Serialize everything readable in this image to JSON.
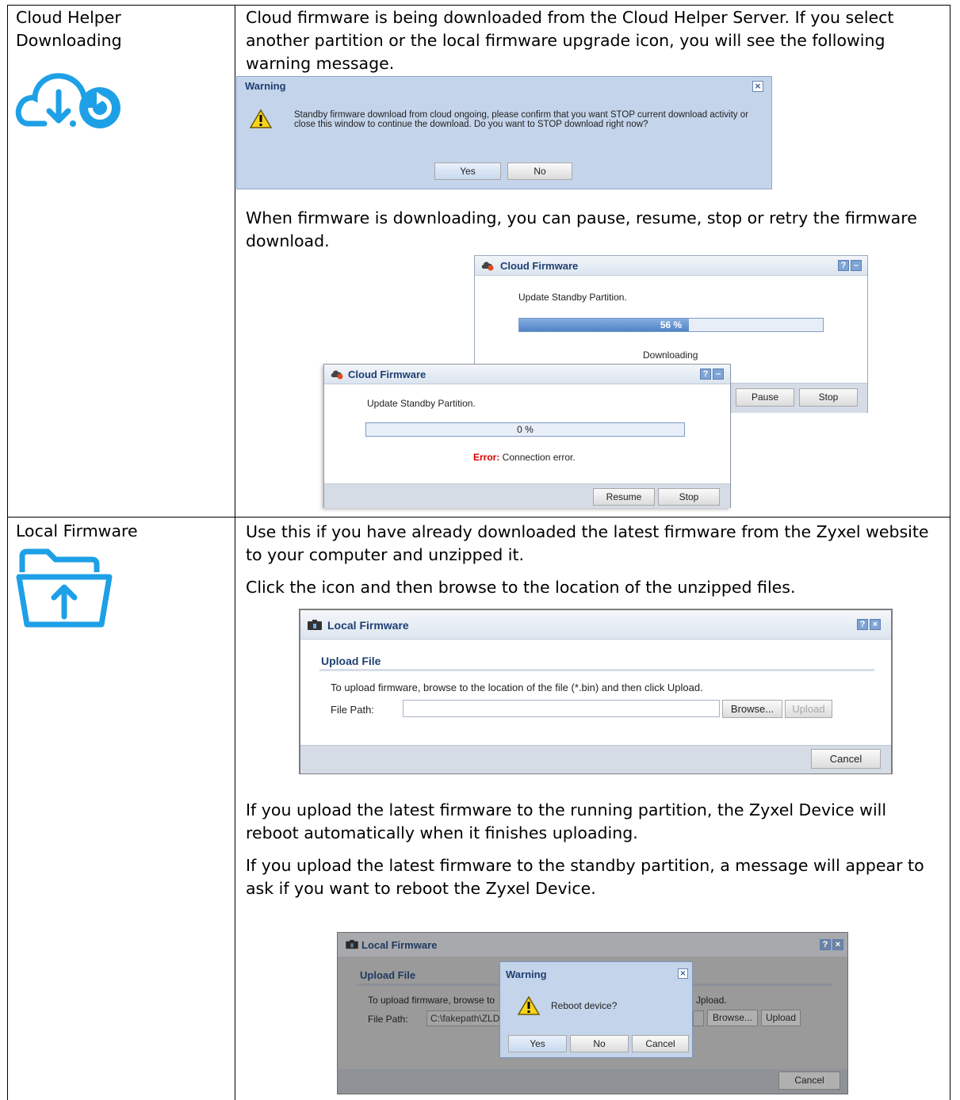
{
  "rows": [
    {
      "label": "Cloud Helper Downloading",
      "icon": "cloud-download-refresh-icon",
      "paragraphs": [
        "Cloud firmware is being downloaded from the Cloud Helper Server. If you select another partition or the local firmware upgrade icon, you will see the following warning message.",
        "When firmware is downloading, you can pause, resume, stop or retry the firmware download."
      ],
      "warning_dialog": {
        "title": "Warning",
        "message": "Standby firmware download from cloud ongoing, please confirm that you want STOP current download activity or close this window to continue the download. Do you want to STOP download right now?",
        "yes": "Yes",
        "no": "No"
      },
      "cloud_dialog_progress": {
        "title": "Cloud Firmware",
        "task": "Update Standby Partition.",
        "progress_text": "56 %",
        "progress": 0.56,
        "status": "Downloading",
        "pause": "Pause",
        "stop": "Stop"
      },
      "cloud_dialog_error": {
        "title": "Cloud Firmware",
        "task": "Update Standby Partition.",
        "progress_text": "0 %",
        "progress": 0,
        "error_label": "Error:",
        "error_text": " Connection error.",
        "resume": "Resume",
        "stop": "Stop"
      }
    },
    {
      "label": "Local Firmware",
      "icon": "folder-upload-icon",
      "paragraphs": [
        "Use this if you have already downloaded the latest firmware from the Zyxel website to your computer and unzipped it.",
        "Click the icon and then browse to the location of the unzipped files.",
        "If you upload the latest firmware to the running partition, the Zyxel Device will reboot automatically when it finishes uploading.",
        "If you upload the latest firmware to the standby partition, a message will appear to ask if you want to reboot the Zyxel Device."
      ],
      "local_dialog": {
        "title": "Local Firmware",
        "section": "Upload File",
        "instruction": "To upload firmware, browse to the location of the file (*.bin) and then click Upload.",
        "file_path_label": "File Path:",
        "file_path_value": "",
        "browse": "Browse...",
        "upload": "Upload",
        "cancel": "Cancel"
      },
      "reboot_screenshot": {
        "title": "Local Firmware",
        "section": "Upload File",
        "instruction_left": "To upload firmware, browse to",
        "instruction_right": "Jpload.",
        "file_path_label": "File Path:",
        "file_path_value": "C:\\fakepath\\ZLD",
        "browse": "Browse...",
        "upload": "Upload",
        "cancel": "Cancel",
        "warning": {
          "title": "Warning",
          "message": "Reboot device?",
          "yes": "Yes",
          "no": "No",
          "cancel": "Cancel"
        }
      }
    }
  ]
}
